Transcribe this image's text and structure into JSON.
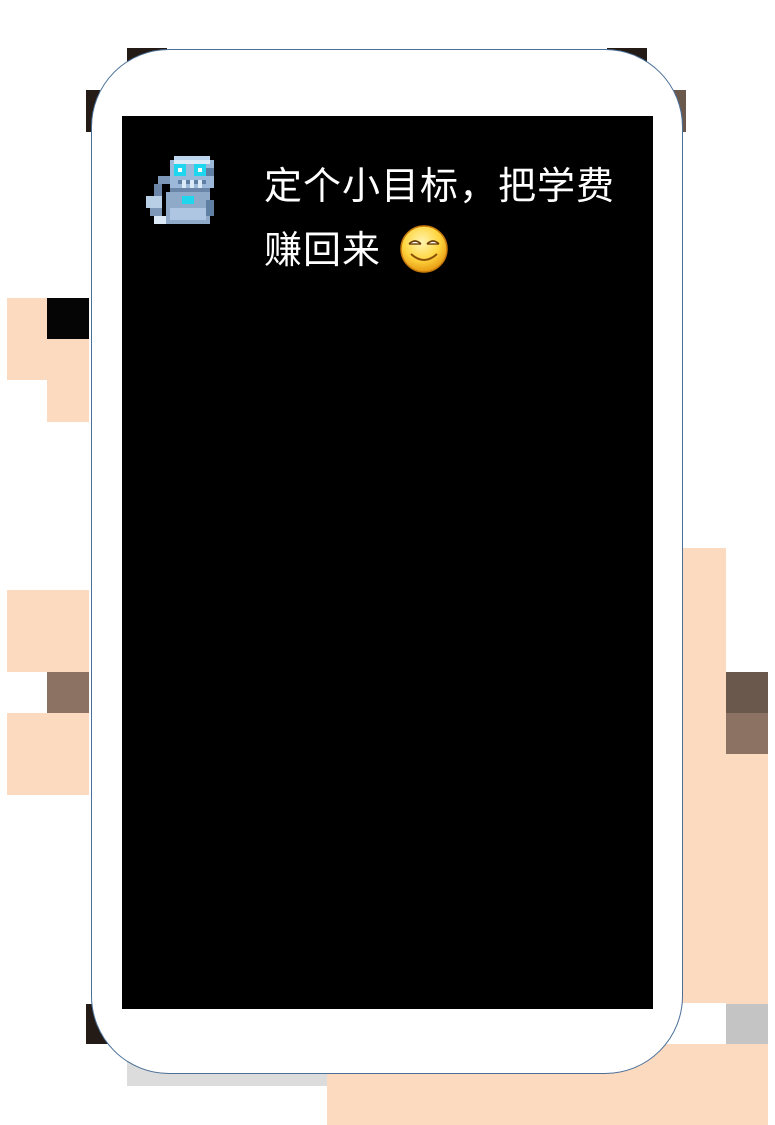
{
  "message": {
    "line1": "定个小目标，把学费",
    "line2": "赚回来",
    "avatar_icon": "robot-icon",
    "emoji_icon": "grinning-smile-emoji-icon"
  },
  "colors": {
    "screen_background": "#000000",
    "text": "#ffffff",
    "phone_frame": "#ffffff",
    "phone_outline": "#4a6f98",
    "hand_skin": "#fcdac0"
  }
}
